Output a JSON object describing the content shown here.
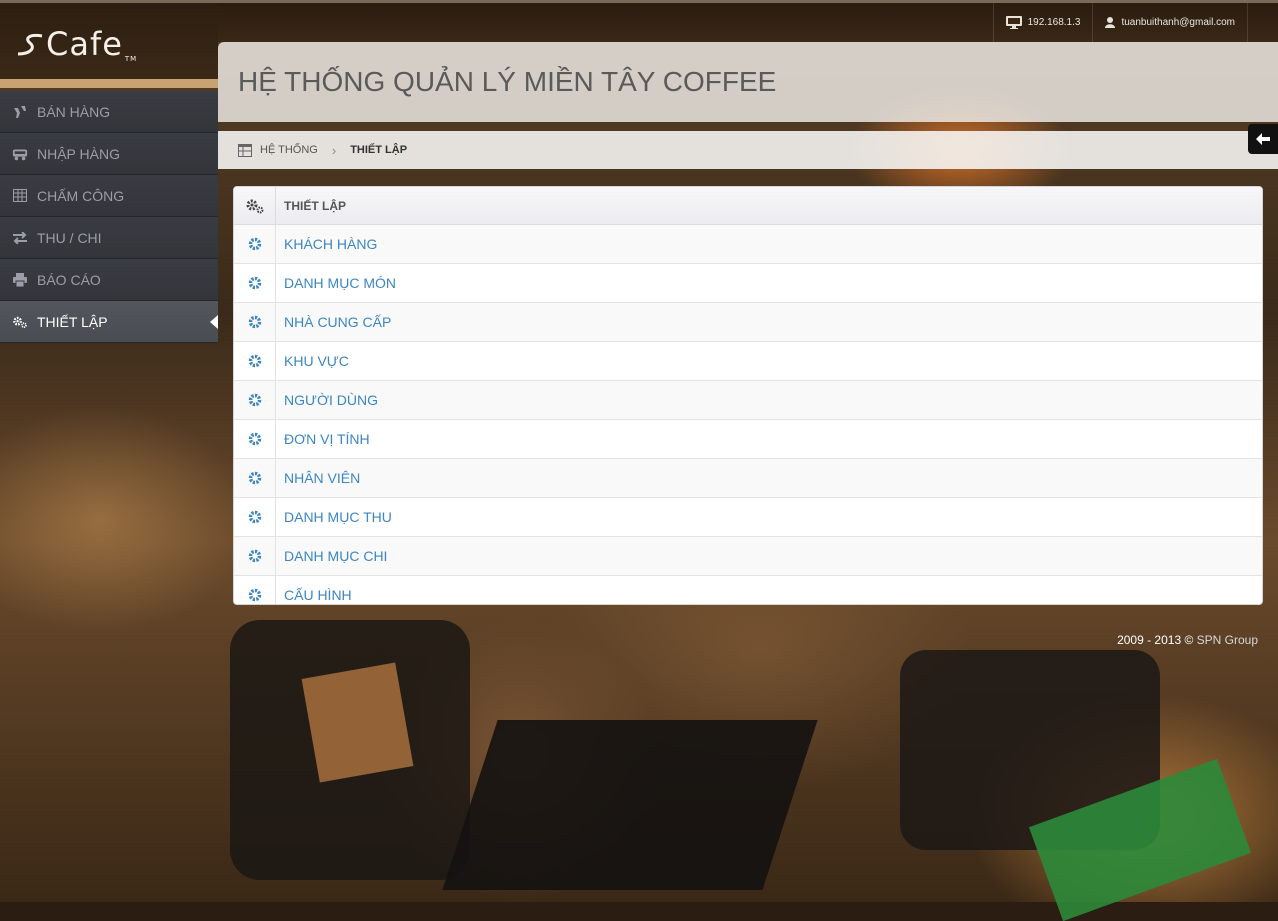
{
  "topbar": {
    "ip": "192.168.1.3",
    "user_email": "tuanbuithanh@gmail.com"
  },
  "logo": {
    "text": "Cafe",
    "tm": "TM"
  },
  "sidebar": {
    "items": [
      {
        "label": "BÁN HÀNG",
        "icon": "coffee-icon"
      },
      {
        "label": "NHẬP HÀNG",
        "icon": "truck-icon"
      },
      {
        "label": "CHẤM CÔNG",
        "icon": "table-icon"
      },
      {
        "label": "THU / CHI",
        "icon": "transfer-icon"
      },
      {
        "label": "BÁO CÁO",
        "icon": "print-icon"
      },
      {
        "label": "THIẾT LẬP",
        "icon": "gears-icon",
        "active": true
      }
    ]
  },
  "header": {
    "title": "HỆ THỐNG QUẢN LÝ MIỀN TÂY COFFEE"
  },
  "breadcrumb": {
    "home": "HỆ THỐNG",
    "current": "THIẾT LẬP"
  },
  "settings": {
    "header": "THIẾT LẬP",
    "items": [
      "KHÁCH HÀNG",
      "DANH MỤC MÓN",
      "NHÀ CUNG CẤP",
      "KHU VỰC",
      "NGƯỜI DÙNG",
      "ĐƠN VỊ TÍNH",
      "NHÂN VIÊN",
      "DANH MỤC THU",
      "DANH MỤC CHI",
      "CẤU HÌNH"
    ]
  },
  "footer": {
    "years": "2009 - 2013 ©",
    "brand": "SPN Group"
  },
  "colors": {
    "accent": "#3c86c3",
    "sidebar": "#3a3c43",
    "active": "#4e5057"
  }
}
